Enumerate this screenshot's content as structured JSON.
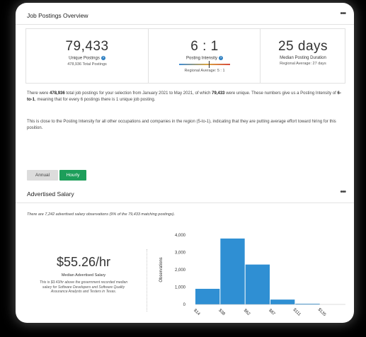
{
  "overview": {
    "title": "Job Postings Overview",
    "menu_icon": "more-horizontal-icon",
    "unique": {
      "value": "79,433",
      "label": "Unique Postings",
      "sub": "478,936 Total Postings"
    },
    "intensity": {
      "value": "6 : 1",
      "label": "Posting Intensity",
      "sub": "Regional Average: 5 : 1",
      "marker_fraction": 0.58
    },
    "duration": {
      "value": "25 days",
      "label": "Median Posting Duration",
      "sub": "Regional Average: 27 days"
    },
    "para1": {
      "t1": "There were ",
      "b1": "478,936",
      "t2": " total job postings for your selection from January 2021 to May 2021, of which ",
      "b2": "79,433",
      "t3": " were unique. These numbers give us a Posting Intensity of ",
      "b3": "6-to-1",
      "t4": ", meaning that for every 6 postings there is 1 unique job posting."
    },
    "para2": "This is close to the Posting Intensity for all other occupations and companies in the region (5-to-1), indicating that they are putting average effort toward hiring for this position."
  },
  "toggles": {
    "annual": "Annual",
    "hourly": "Hourly",
    "active": "Hourly"
  },
  "salary": {
    "title": "Advertised Salary",
    "note": "There are 7,242 advertised salary observations (9% of the 79,433 matching postings).",
    "value": "$55.26/hr",
    "label": "Median Advertised Salary",
    "desc": "This is $3.43/hr above the government recorded median salary for Software Developers and Software Quality Assurance Analysts and Testers in Texas."
  },
  "colors": {
    "accent": "#2d7fc1",
    "bar": "#2f8fd3",
    "toggle_active": "#1d9e5a"
  },
  "chart_data": {
    "type": "bar",
    "ylabel": "Observations",
    "xlabel": "",
    "ylim": [
      0,
      4000
    ],
    "yticks": [
      0,
      1000,
      2000,
      3000,
      4000
    ],
    "ytick_labels": [
      "0",
      "1,000",
      "2,000",
      "3,000",
      "4,000"
    ],
    "xtick_labels": [
      "$14",
      "$38",
      "$62",
      "$87",
      "$111",
      "$135"
    ],
    "bin_edges": [
      14,
      38,
      62,
      87,
      111,
      135
    ],
    "values": [
      900,
      3800,
      2300,
      280,
      40,
      0
    ]
  }
}
